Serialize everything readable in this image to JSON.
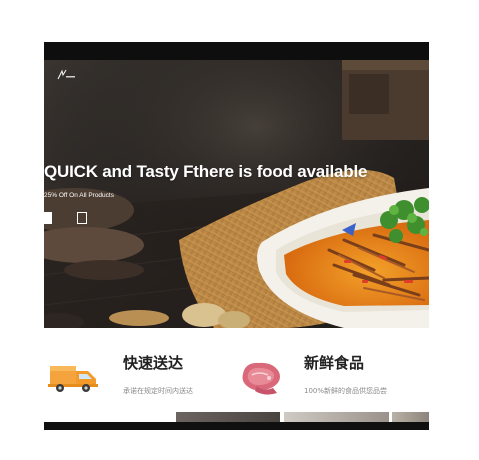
{
  "hero": {
    "title": "QUICK and Tasty Fthere is food available",
    "subtitle": "25% Off On All Products",
    "primary_button": "",
    "secondary_button": ""
  },
  "features": [
    {
      "title": "快速送达",
      "description": "承诺在规定时间内送达",
      "icon": "delivery-truck-icon"
    },
    {
      "title": "新鲜食品",
      "description": "100%新鲜的食品供您品尝",
      "icon": "fresh-meat-icon"
    }
  ],
  "colors": {
    "hero_text": "#ffffff",
    "truck_orange": "#f5a33c",
    "meat_pink": "#d9697a",
    "title_text": "#222222",
    "muted_text": "#8a8a8a"
  }
}
